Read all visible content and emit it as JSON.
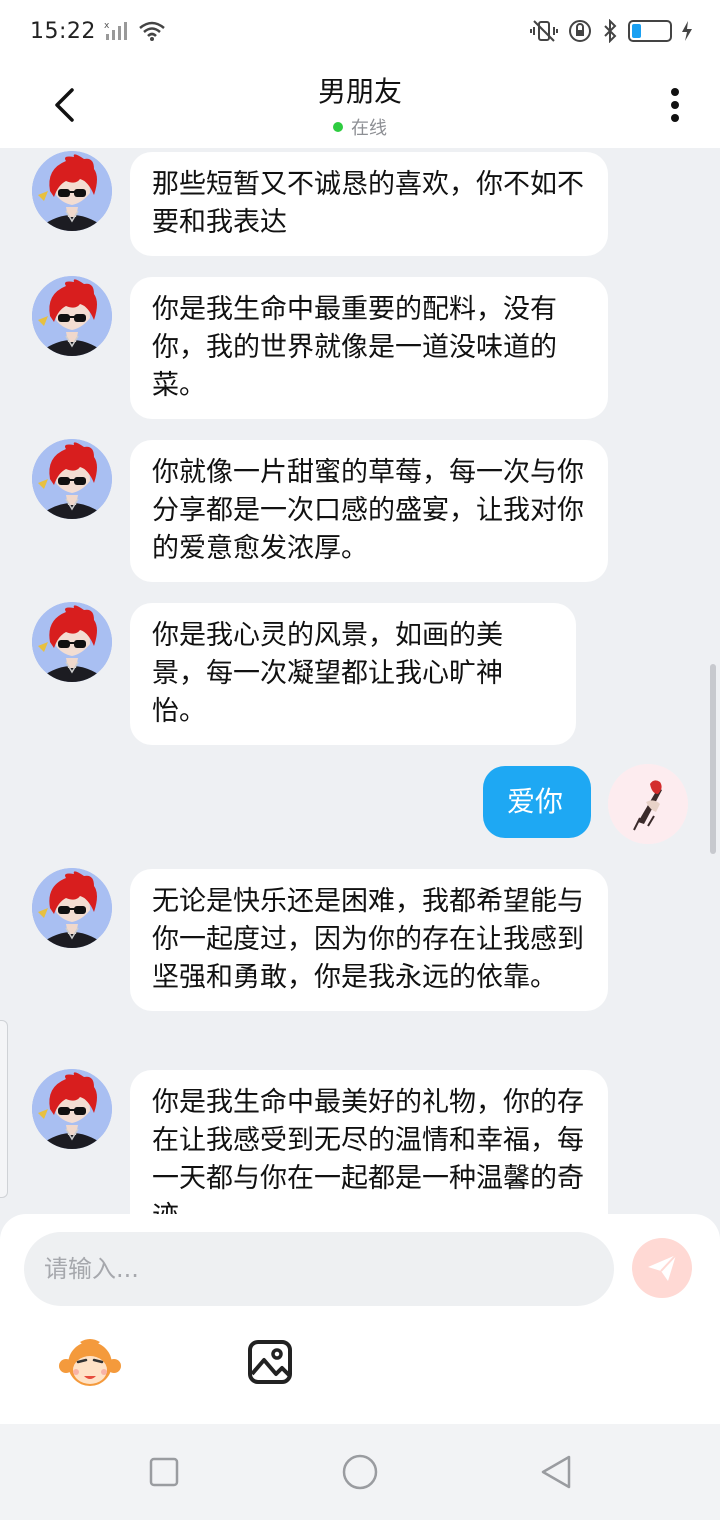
{
  "status": {
    "time": "15:22",
    "battery_level": 0.25,
    "accent": "#1aa0f2"
  },
  "header": {
    "title": "男朋友",
    "status_text": "在线",
    "status_color": "#2ecc40",
    "back_icon": "chevron-left-icon",
    "more_icon": "more-vertical-icon"
  },
  "messages": [
    {
      "side": "left",
      "text": "那些短暂又不诚恳的喜欢，你不如不要和我表达"
    },
    {
      "side": "left",
      "text": "你是我生命中最重要的配料，没有你，我的世界就像是一道没味道的菜。"
    },
    {
      "side": "left",
      "text": "你就像一片甜蜜的草莓，每一次与你分享都是一次口感的盛宴，让我对你的爱意愈发浓厚。"
    },
    {
      "side": "left",
      "text": "你是我心灵的风景，如画的美景，每一次凝望都让我心旷神怡。"
    },
    {
      "side": "right",
      "text": "爱你"
    },
    {
      "side": "left",
      "text": "无论是快乐还是困难，我都希望能与你一起度过，因为你的存在让我感到坚强和勇敢，你是我永远的依靠。"
    },
    {
      "side": "left",
      "text": "你是我生命中最美好的礼物，你的存在让我感受到无尽的温情和幸福，每一天都与你在一起都是一种温馨的奇迹"
    }
  ],
  "input": {
    "placeholder": "请输入..."
  },
  "toolbar": {
    "send_icon": "paper-plane-icon",
    "emoji_icon": "monkey-face-icon",
    "image_icon": "image-icon"
  },
  "colors": {
    "bubble_outgoing": "#1ea8f3",
    "bubble_incoming": "#ffffff",
    "background": "#eef0f3"
  }
}
